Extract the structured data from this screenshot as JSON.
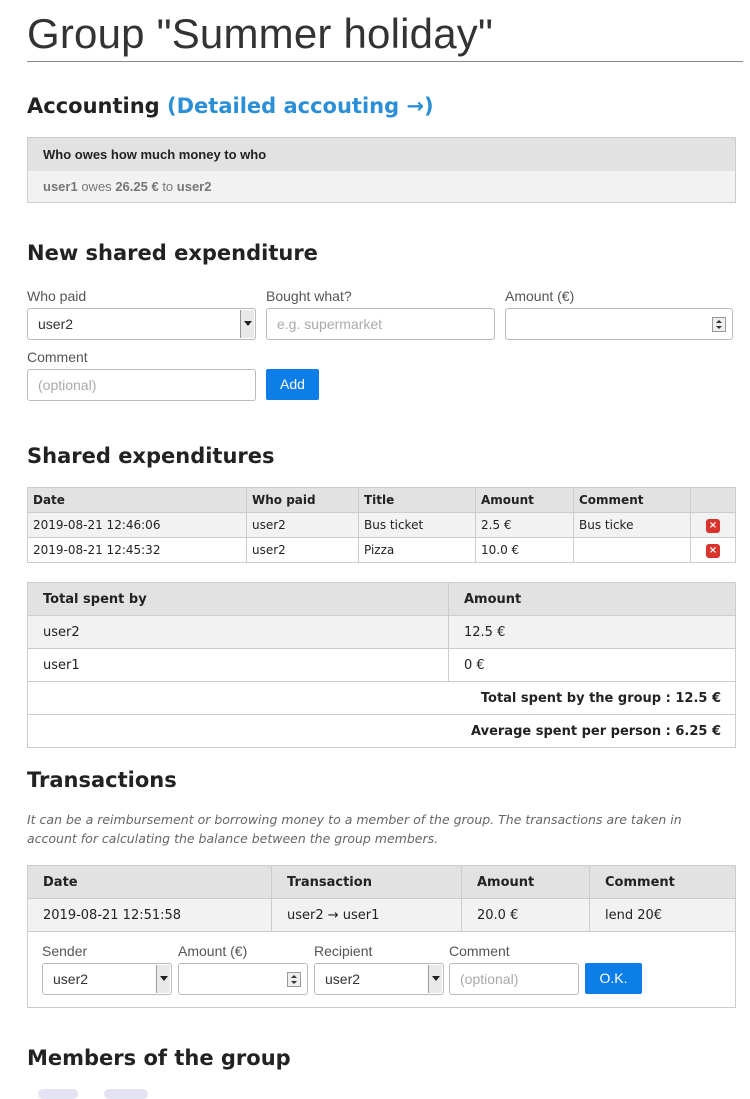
{
  "page": {
    "title": "Group \"Summer holiday\""
  },
  "accounting": {
    "heading": "Accounting",
    "detail_link": "(Detailed accouting →)",
    "panel_title": "Who owes how much money to who",
    "debt": {
      "debtor": "user1",
      "owes": "owes",
      "amount": "26.25 €",
      "to": "to",
      "creditor": "user2"
    }
  },
  "new_expense": {
    "heading": "New shared expenditure",
    "who_paid_label": "Who paid",
    "who_paid_value": "user2",
    "bought_label": "Bought what?",
    "bought_placeholder": "e.g. supermarket",
    "amount_label": "Amount (€)",
    "amount_value": "",
    "comment_label": "Comment",
    "comment_placeholder": "(optional)",
    "add_button": "Add"
  },
  "expenses": {
    "heading": "Shared expenditures",
    "columns": [
      "Date",
      "Who paid",
      "Title",
      "Amount",
      "Comment",
      ""
    ],
    "rows": [
      {
        "date": "2019-08-21 12:46:06",
        "who": "user2",
        "title": "Bus ticket",
        "amount": "2.5 €",
        "comment": "Bus ticke",
        "delete": "×"
      },
      {
        "date": "2019-08-21 12:45:32",
        "who": "user2",
        "title": "Pizza",
        "amount": "10.0 €",
        "comment": "",
        "delete": "×"
      }
    ]
  },
  "totals": {
    "columns": [
      "Total spent by",
      "Amount"
    ],
    "rows": [
      {
        "user": "user2",
        "amount": "12.5 €"
      },
      {
        "user": "user1",
        "amount": "0 €"
      }
    ],
    "group_total": "Total spent by the group : 12.5 €",
    "average": "Average spent per person : 6.25 €"
  },
  "transactions": {
    "heading": "Transactions",
    "note": "It can be a reimbursement or borrowing money to a member of the group. The transactions are taken in account for calculating the balance between the group members.",
    "columns": [
      "Date",
      "Transaction",
      "Amount",
      "Comment"
    ],
    "rows": [
      {
        "date": "2019-08-21 12:51:58",
        "transaction": "user2 → user1",
        "amount": "20.0 €",
        "comment": "lend 20€"
      }
    ],
    "form": {
      "sender_label": "Sender",
      "sender_value": "user2",
      "amount_label": "Amount (€)",
      "amount_value": "",
      "recipient_label": "Recipient",
      "recipient_value": "user2",
      "comment_label": "Comment",
      "comment_placeholder": "(optional)",
      "ok_button": "O.K."
    }
  },
  "members": {
    "heading": "Members of the group"
  }
}
